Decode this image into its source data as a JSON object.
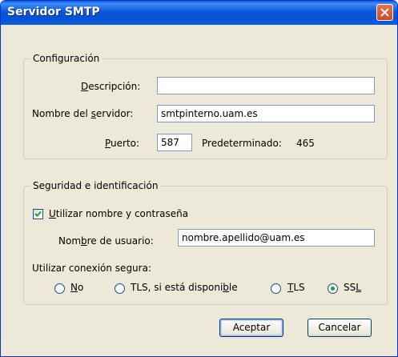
{
  "window": {
    "title": "Servidor SMTP"
  },
  "config": {
    "legend": "Configuración",
    "description_label": "Descripción:",
    "description_value": "",
    "server_label": "Nombre del servidor:",
    "server_value": "smtpinterno.uam.es",
    "port_label": "Puerto:",
    "port_value": "587",
    "default_label": "Predeterminado:",
    "default_value": "465"
  },
  "security": {
    "legend": "Seguridad e identificación",
    "use_auth_label": "Utilizar nombre y contraseña",
    "use_auth_checked": true,
    "username_label": "Nombre de usuario:",
    "username_value": "nombre.apellido@uam.es",
    "secure_label": "Utilizar conexión segura:",
    "options": [
      "No",
      "TLS, si está disponible",
      "TLS",
      "SSL"
    ],
    "selected": "SSL"
  },
  "buttons": {
    "ok": "Aceptar",
    "cancel": "Cancelar"
  },
  "colors": {
    "titlebar": "#0651d3",
    "close": "#d4461f",
    "check": "#21a121"
  }
}
